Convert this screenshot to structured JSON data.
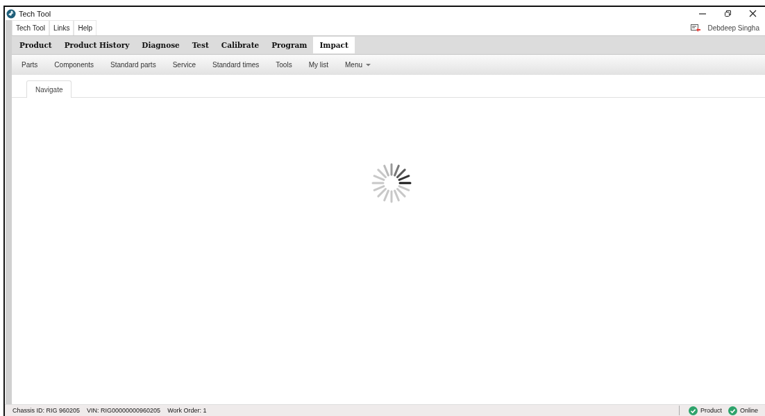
{
  "window": {
    "title": "Tech Tool"
  },
  "menu": [
    {
      "label": "Tech Tool"
    },
    {
      "label": "Links"
    },
    {
      "label": "Help"
    }
  ],
  "user": {
    "name": "Debdeep Singha"
  },
  "main_tabs": [
    {
      "label": "Product",
      "selected": false
    },
    {
      "label": "Product History",
      "selected": false
    },
    {
      "label": "Diagnose",
      "selected": false
    },
    {
      "label": "Test",
      "selected": false
    },
    {
      "label": "Calibrate",
      "selected": false
    },
    {
      "label": "Program",
      "selected": false
    },
    {
      "label": "Impact",
      "selected": true
    }
  ],
  "sub_menu": [
    {
      "label": "Parts",
      "kind": "link"
    },
    {
      "label": "Components",
      "kind": "link"
    },
    {
      "label": "Standard parts",
      "kind": "link"
    },
    {
      "label": "Service",
      "kind": "link"
    },
    {
      "label": "Standard times",
      "kind": "link"
    },
    {
      "label": "Tools",
      "kind": "link"
    },
    {
      "label": "My list",
      "kind": "link"
    },
    {
      "label": "Menu",
      "kind": "dropdown"
    }
  ],
  "content_tabs": [
    {
      "label": "Navigate",
      "selected": true
    }
  ],
  "content": {
    "loading": true
  },
  "status_bar": {
    "items": [
      "Chassis ID: RIG 960205",
      "VIN: RIG00000000960205",
      "Work Order: 1"
    ],
    "indicators": [
      {
        "label": "Product",
        "ok": true
      },
      {
        "label": "Online",
        "ok": true
      }
    ]
  }
}
